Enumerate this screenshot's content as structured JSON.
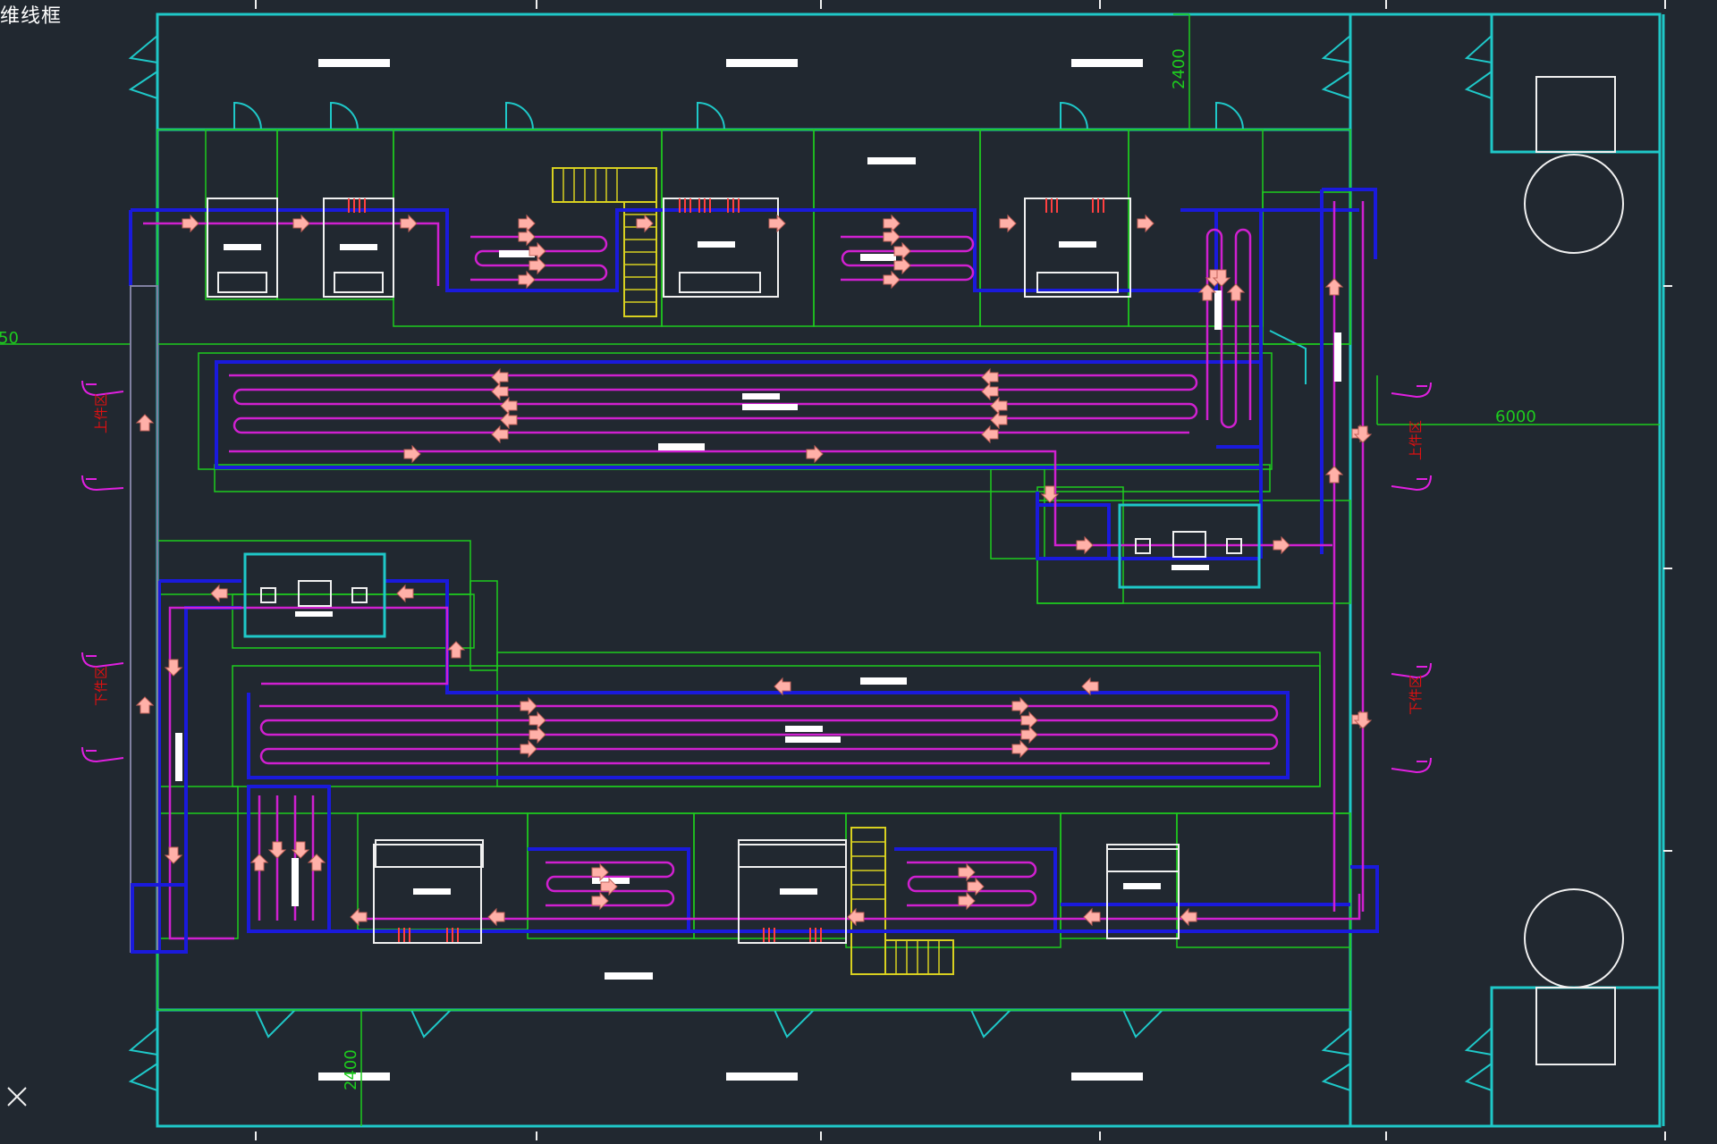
{
  "viewport": {
    "title": "维线框",
    "close_icon": "close-x-icon"
  },
  "dimensions": {
    "top_height": "2400",
    "bottom_height": "2400",
    "right_width": "6000",
    "left_edge": "50"
  },
  "zone_labels": {
    "upper_left": "上件区",
    "lower_left": "下件区",
    "upper_right": "上件区",
    "lower_right": "下件区"
  },
  "colors": {
    "background": "#212830",
    "wall": "#1fc8c8",
    "dimension": "#1ecc1e",
    "conveyor": "#1a1adc",
    "track": "#d020d0",
    "arrow": "#ffb0a8",
    "stairs": "#d8d020",
    "equipment": "#f0f0f0",
    "zone_text": "#e01010"
  }
}
